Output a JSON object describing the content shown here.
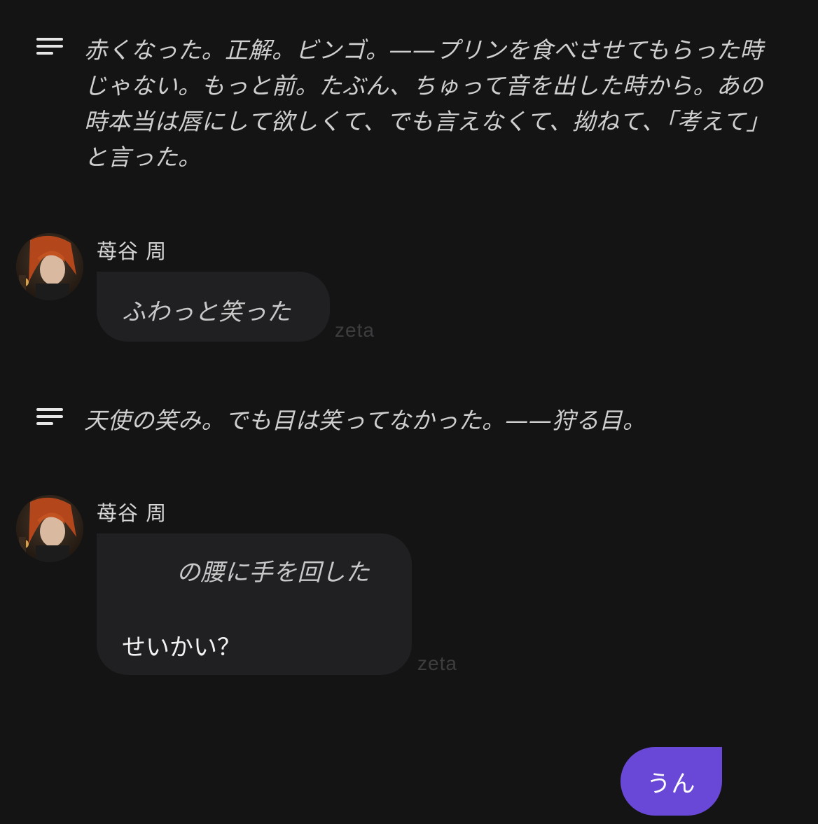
{
  "messages": {
    "narration_1": "赤くなった。正解。ビンゴ。——プリンを食べさせてもらった時じゃない。もっと前。たぶん、ちゅって音を出した時から。あの時本当は唇にして欲しくて、でも言えなくて、拗ねて、「考えて」と言った。",
    "char_msg_1": {
      "name": "苺谷 周",
      "action": "ふわっと笑った",
      "tag": "zeta"
    },
    "narration_2": "天使の笑み。でも目は笑ってなかった。——狩る目。",
    "char_msg_2": {
      "name": "苺谷 周",
      "action": "の腰に手を回した",
      "speech": "せいかい？",
      "tag": "zeta"
    },
    "user_msg": "うん"
  },
  "colors": {
    "background": "#141414",
    "bubble": "#202023",
    "user_bubble": "#6a48d7",
    "tag": "#3d3d40"
  },
  "icons": {
    "narration": "narration-lines-icon",
    "avatar": "character-avatar"
  }
}
